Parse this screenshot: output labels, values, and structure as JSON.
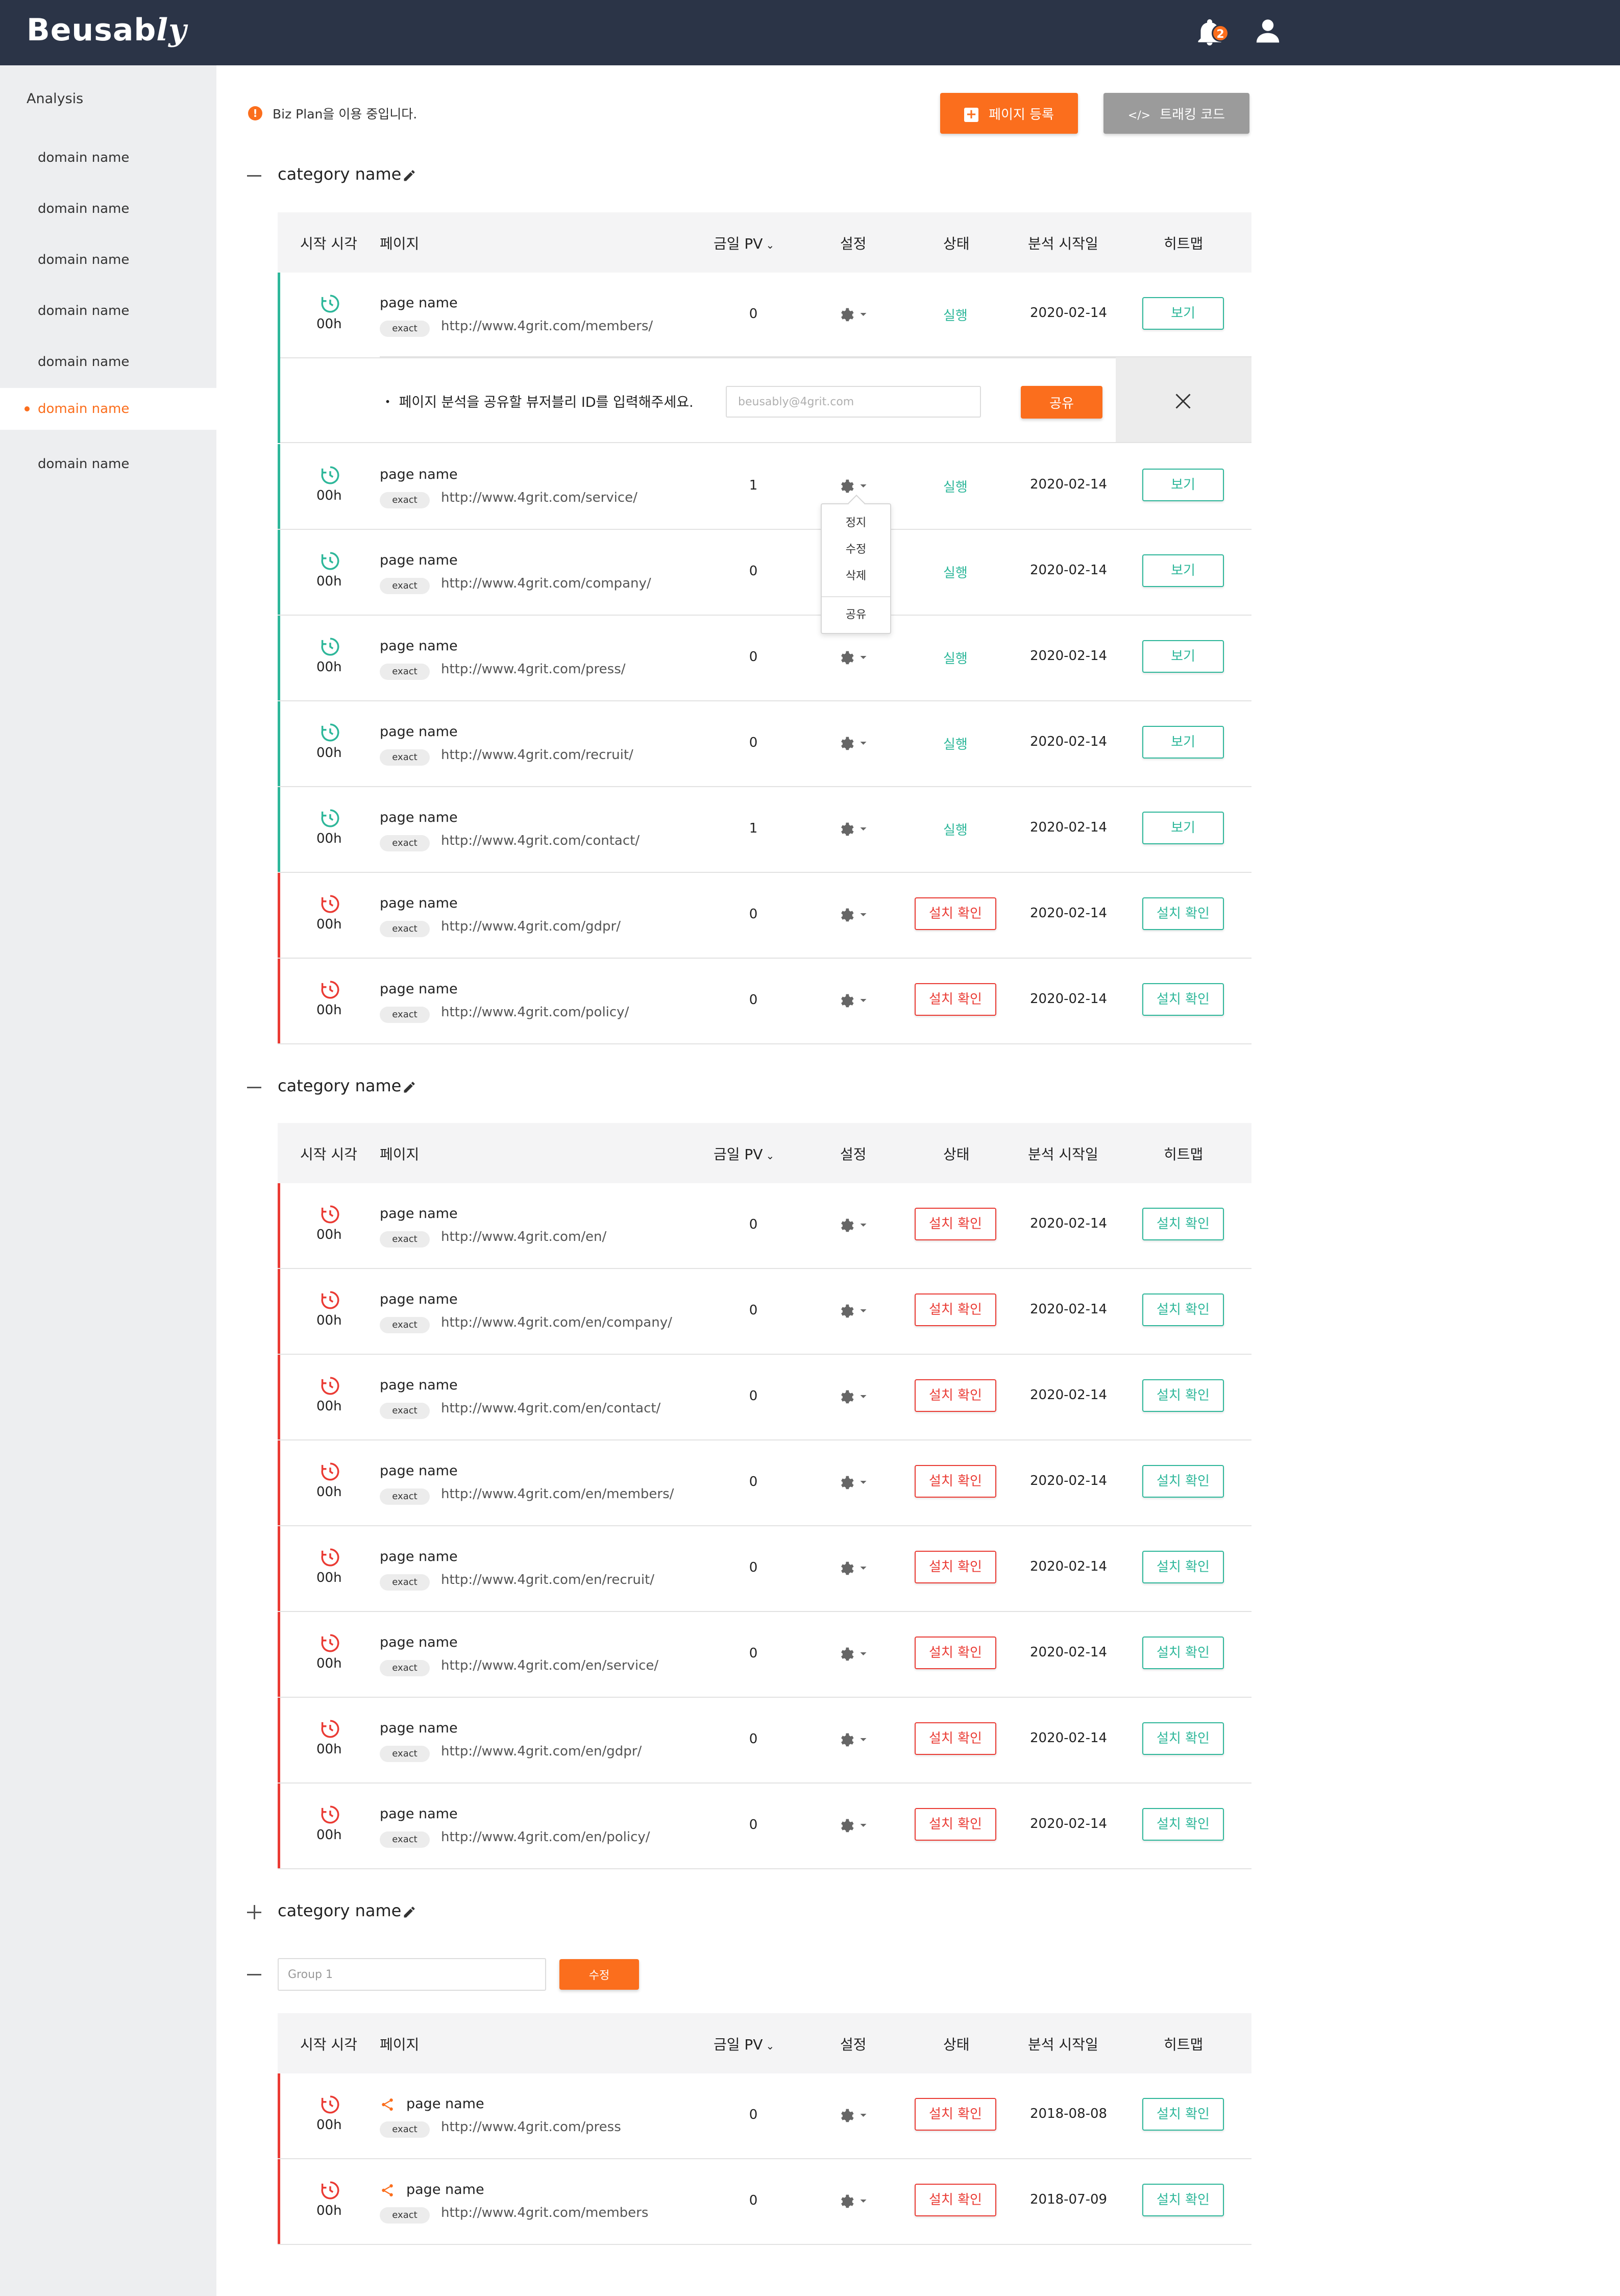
{
  "topbar": {
    "logo_main": "Beusab",
    "logo_tail": "ly",
    "notification_count": "2"
  },
  "sidebar": {
    "title": "Analysis",
    "items": [
      {
        "label": "domain name"
      },
      {
        "label": "domain name"
      },
      {
        "label": "domain name"
      },
      {
        "label": "domain name"
      },
      {
        "label": "domain name"
      },
      {
        "label": "domain name",
        "active": true
      },
      {
        "label": "domain name"
      }
    ]
  },
  "notice": {
    "icon": "!",
    "text": "Biz Plan을 이용 중입니다."
  },
  "actions": {
    "register_label": "페이지 등록",
    "register_icon": "+",
    "tracking_label": "트래킹 코드",
    "tracking_icon": "</>"
  },
  "table_headers": {
    "start": "시작 시각",
    "page": "페이지",
    "pv": "금일 PV",
    "settings": "설정",
    "status": "상태",
    "date": "분석 시작일",
    "heatmap": "히트맵"
  },
  "colors": {
    "brand": "#fb6e1d",
    "running": "#2eb79a",
    "install": "#ea3b34",
    "topbar": "#2b3447"
  },
  "categories": [
    {
      "name": "category name",
      "expanded": true,
      "rows": [
        {
          "hours": "00h",
          "page": "page name",
          "match": "exact",
          "url": "http://www.4grit.com/members/",
          "pv": "0",
          "status": "실행",
          "date": "2020-02-14",
          "heatmap": "보기"
        },
        {
          "hours": "00h",
          "page": "page name",
          "match": "exact",
          "url": "http://www.4grit.com/service/",
          "pv": "1",
          "status": "실행",
          "date": "2020-02-14",
          "heatmap": "보기"
        },
        {
          "hours": "00h",
          "page": "page name",
          "match": "exact",
          "url": "http://www.4grit.com/company/",
          "pv": "0",
          "status": "실행",
          "date": "2020-02-14",
          "heatmap": "보기"
        },
        {
          "hours": "00h",
          "page": "page name",
          "match": "exact",
          "url": "http://www.4grit.com/press/",
          "pv": "0",
          "status": "실행",
          "date": "2020-02-14",
          "heatmap": "보기"
        },
        {
          "hours": "00h",
          "page": "page name",
          "match": "exact",
          "url": "http://www.4grit.com/recruit/",
          "pv": "0",
          "status": "실행",
          "date": "2020-02-14",
          "heatmap": "보기"
        },
        {
          "hours": "00h",
          "page": "page name",
          "match": "exact",
          "url": "http://www.4grit.com/contact/",
          "pv": "1",
          "status": "실행",
          "date": "2020-02-14",
          "heatmap": "보기"
        },
        {
          "hours": "00h",
          "page": "page name",
          "match": "exact",
          "url": "http://www.4grit.com/gdpr/",
          "pv": "0",
          "status": "설치 확인",
          "date": "2020-02-14",
          "heatmap": "설치 확인"
        },
        {
          "hours": "00h",
          "page": "page name",
          "match": "exact",
          "url": "http://www.4grit.com/policy/",
          "pv": "0",
          "status": "설치 확인",
          "date": "2020-02-14",
          "heatmap": "설치 확인"
        }
      ]
    },
    {
      "name": "category name",
      "expanded": true,
      "rows": [
        {
          "hours": "00h",
          "page": "page name",
          "match": "exact",
          "url": "http://www.4grit.com/en/",
          "pv": "0",
          "status": "설치 확인",
          "date": "2020-02-14",
          "heatmap": "설치 확인"
        },
        {
          "hours": "00h",
          "page": "page name",
          "match": "exact",
          "url": "http://www.4grit.com/en/company/",
          "pv": "0",
          "status": "설치 확인",
          "date": "2020-02-14",
          "heatmap": "설치 확인"
        },
        {
          "hours": "00h",
          "page": "page name",
          "match": "exact",
          "url": "http://www.4grit.com/en/contact/",
          "pv": "0",
          "status": "설치 확인",
          "date": "2020-02-14",
          "heatmap": "설치 확인"
        },
        {
          "hours": "00h",
          "page": "page name",
          "match": "exact",
          "url": "http://www.4grit.com/en/members/",
          "pv": "0",
          "status": "설치 확인",
          "date": "2020-02-14",
          "heatmap": "설치 확인"
        },
        {
          "hours": "00h",
          "page": "page name",
          "match": "exact",
          "url": "http://www.4grit.com/en/recruit/",
          "pv": "0",
          "status": "설치 확인",
          "date": "2020-02-14",
          "heatmap": "설치 확인"
        },
        {
          "hours": "00h",
          "page": "page name",
          "match": "exact",
          "url": "http://www.4grit.com/en/service/",
          "pv": "0",
          "status": "설치 확인",
          "date": "2020-02-14",
          "heatmap": "설치 확인"
        },
        {
          "hours": "00h",
          "page": "page name",
          "match": "exact",
          "url": "http://www.4grit.com/en/gdpr/",
          "pv": "0",
          "status": "설치 확인",
          "date": "2020-02-14",
          "heatmap": "설치 확인"
        },
        {
          "hours": "00h",
          "page": "page name",
          "match": "exact",
          "url": "http://www.4grit.com/en/policy/",
          "pv": "0",
          "status": "설치 확인",
          "date": "2020-02-14",
          "heatmap": "설치 확인"
        }
      ]
    },
    {
      "name": "category name",
      "expanded": false
    },
    {
      "group_input_value": "Group 1",
      "edit_label": "수정",
      "rows": [
        {
          "hours": "00h",
          "page": "page name",
          "match": "exact",
          "url": "http://www.4grit.com/press",
          "pv": "0",
          "status": "설치 확인",
          "date": "2018-08-08",
          "heatmap": "설치 확인",
          "shared": true
        },
        {
          "hours": "00h",
          "page": "page name",
          "match": "exact",
          "url": "http://www.4grit.com/members",
          "pv": "0",
          "status": "설치 확인",
          "date": "2018-07-09",
          "heatmap": "설치 확인",
          "shared": true
        }
      ]
    }
  ],
  "share_panel": {
    "message": "・ 페이지 분석을 공유할 뷰저블리 ID를 입력해주세요.",
    "placeholder": "beusably@4grit.com",
    "button": "공유"
  },
  "gear_menu": {
    "items": [
      "정지",
      "수정",
      "삭제"
    ],
    "share": "공유"
  }
}
